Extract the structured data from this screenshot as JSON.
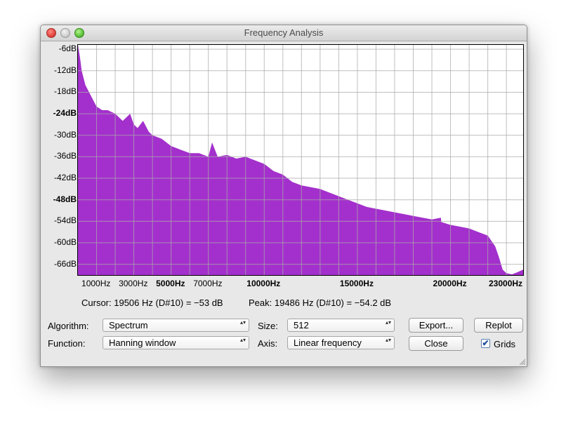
{
  "window": {
    "title": "Frequency Analysis"
  },
  "chart_data": {
    "type": "area",
    "title": "",
    "xlabel": "",
    "ylabel": "",
    "y_unit": "dB",
    "xlim": [
      0,
      23900
    ],
    "ylim": [
      -69,
      -4.8
    ],
    "fill_color": "#a330cc",
    "y_ticks": [
      "-6dB",
      "-12dB",
      "-18dB",
      "-24dB",
      "-30dB",
      "-36dB",
      "-42dB",
      "-48dB",
      "-54dB",
      "-60dB",
      "-66dB"
    ],
    "y_tick_values": [
      -6,
      -12,
      -18,
      -24,
      -30,
      -36,
      -42,
      -48,
      -54,
      -60,
      -66
    ],
    "y_bold_ticks": [
      "-24dB",
      "-48dB"
    ],
    "x_ticks": [
      "1000Hz",
      "3000Hz",
      "5000Hz",
      "7000Hz",
      "10000Hz",
      "15000Hz",
      "20000Hz",
      "23000Hz"
    ],
    "x_tick_values": [
      1000,
      3000,
      5000,
      7000,
      10000,
      15000,
      20000,
      23000
    ],
    "x_bold_ticks": [
      "5000Hz",
      "10000Hz",
      "15000Hz",
      "20000Hz",
      "23000Hz"
    ],
    "grid": true,
    "x": [
      0,
      100,
      200,
      400,
      600,
      800,
      1000,
      1300,
      1600,
      2000,
      2400,
      2800,
      3000,
      3200,
      3500,
      3800,
      4000,
      4500,
      5000,
      5500,
      6000,
      6500,
      7000,
      7200,
      7500,
      8000,
      8500,
      9000,
      9500,
      10000,
      10500,
      11000,
      11500,
      12000,
      12500,
      13000,
      13500,
      14000,
      14500,
      15000,
      15500,
      16000,
      16500,
      17000,
      17500,
      18000,
      18500,
      19000,
      19486,
      19500,
      20000,
      20500,
      21000,
      21500,
      22000,
      22400,
      22600,
      22800,
      23000,
      23300,
      23600,
      23900
    ],
    "y": [
      -4.8,
      -8,
      -12,
      -16,
      -18,
      -20,
      -22,
      -23,
      -23,
      -24,
      -26,
      -24,
      -27,
      -28,
      -26,
      -29,
      -30,
      -31,
      -33,
      -34,
      -35,
      -35,
      -36,
      -32,
      -36,
      -35.5,
      -36.5,
      -36,
      -37,
      -38,
      -40,
      -41,
      -43,
      -44,
      -44.5,
      -45,
      -46,
      -47,
      -48,
      -49,
      -50,
      -50.5,
      -51,
      -51.5,
      -52,
      -52.5,
      -53,
      -53.5,
      -53,
      -54.2,
      -55,
      -55.5,
      -56,
      -57,
      -58,
      -61,
      -64,
      -67.5,
      -68.5,
      -68.8,
      -68.2,
      -67.5
    ]
  },
  "readout": {
    "cursor": "Cursor: 19506 Hz (D#10) = −53 dB",
    "peak": "Peak: 19486 Hz (D#10) = −54.2 dB"
  },
  "controls": {
    "algorithm_label": "Algorithm:",
    "algorithm_value": "Spectrum",
    "function_label": "Function:",
    "function_value": "Hanning window",
    "size_label": "Size:",
    "size_value": "512",
    "axis_label": "Axis:",
    "axis_value": "Linear frequency",
    "export_label": "Export...",
    "replot_label": "Replot",
    "close_label": "Close",
    "grids_label": "Grids",
    "grids_checked": true
  },
  "icons": {
    "popup_arrows": "▴▾",
    "checkmark": "✔"
  }
}
